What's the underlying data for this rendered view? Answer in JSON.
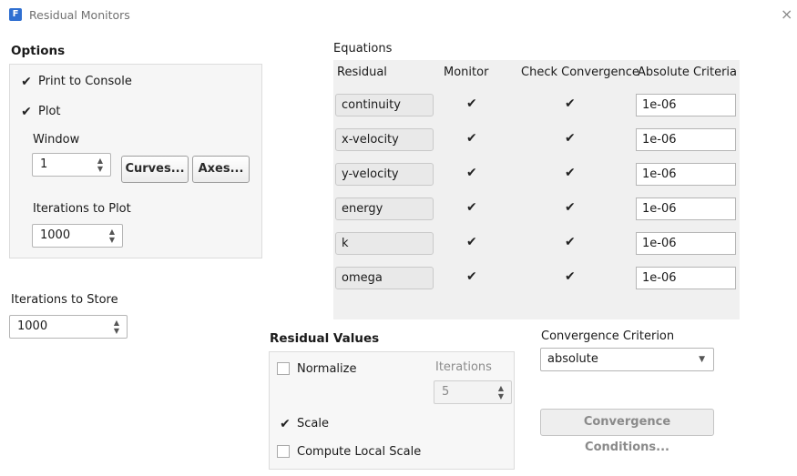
{
  "window": {
    "title": "Residual Monitors",
    "close_glyph": "×"
  },
  "options": {
    "title": "Options",
    "print_to_console": {
      "label": "Print to Console",
      "checked": true
    },
    "plot": {
      "label": "Plot",
      "checked": true
    },
    "window_label": "Window",
    "window_value": "1",
    "curves_button": "Curves...",
    "axes_button": "Axes...",
    "iterations_to_plot_label": "Iterations to Plot",
    "iterations_to_plot_value": "1000"
  },
  "iterations_to_store": {
    "label": "Iterations to Store",
    "value": "1000"
  },
  "equations": {
    "title": "Equations",
    "headers": {
      "residual": "Residual",
      "monitor": "Monitor",
      "check": "Check Convergence",
      "criteria": "Absolute Criteria"
    },
    "rows": [
      {
        "residual": "continuity",
        "monitor": true,
        "check": true,
        "criteria": "1e-06"
      },
      {
        "residual": "x-velocity",
        "monitor": true,
        "check": true,
        "criteria": "1e-06"
      },
      {
        "residual": "y-velocity",
        "monitor": true,
        "check": true,
        "criteria": "1e-06"
      },
      {
        "residual": "energy",
        "monitor": true,
        "check": true,
        "criteria": "1e-06"
      },
      {
        "residual": "k",
        "monitor": true,
        "check": true,
        "criteria": "1e-06"
      },
      {
        "residual": "omega",
        "monitor": true,
        "check": true,
        "criteria": "1e-06"
      }
    ]
  },
  "residual_values": {
    "title": "Residual Values",
    "normalize": {
      "label": "Normalize",
      "checked": false
    },
    "iterations_label": "Iterations",
    "iterations_value": "5",
    "scale": {
      "label": "Scale",
      "checked": true
    },
    "compute_local_scale": {
      "label": "Compute Local Scale",
      "checked": false
    }
  },
  "convergence": {
    "criterion_label": "Convergence Criterion",
    "criterion_value": "absolute",
    "conditions_button": "Convergence Conditions..."
  },
  "glyphs": {
    "check": "✔",
    "spin_up": "▲",
    "spin_down": "▼",
    "caret": "▼"
  },
  "colors": {
    "app_icon": "#2f6fd1",
    "panel_bg": "#f0f0f0"
  }
}
